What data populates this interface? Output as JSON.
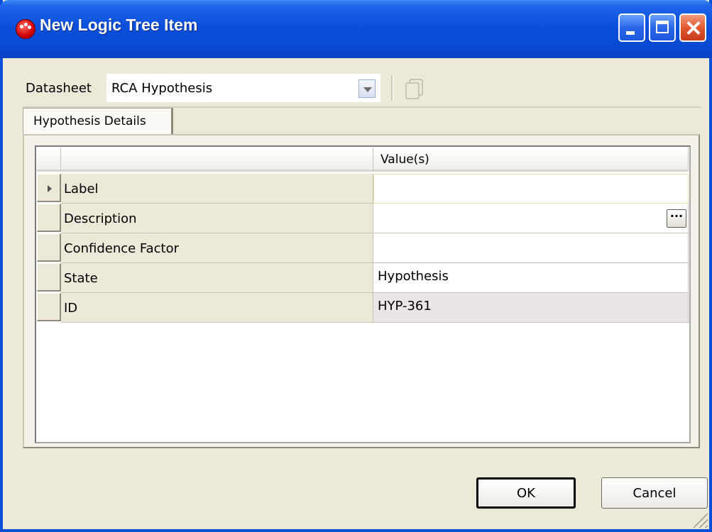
{
  "window": {
    "title": "New Logic Tree Item",
    "app_icon": "red-ball-icon",
    "controls": [
      "minimize-icon",
      "maximize-icon",
      "close-icon"
    ]
  },
  "datasheet": {
    "label": "Datasheet",
    "value": "RCA Hypothesis"
  },
  "tabs": [
    {
      "label": "Hypothesis Details",
      "selected": true
    }
  ],
  "grid": {
    "columns": [
      "",
      "Value(s)"
    ],
    "rows": [
      {
        "label": "Label",
        "value": "",
        "current": true
      },
      {
        "label": "Description",
        "value": "",
        "has_ellipsis": true
      },
      {
        "label": "Confidence Factor",
        "value": ""
      },
      {
        "label": "State",
        "value": "Hypothesis"
      },
      {
        "label": "ID",
        "value": "HYP-361",
        "read_only": true
      }
    ]
  },
  "buttons": {
    "ok": "OK",
    "cancel": "Cancel"
  },
  "colors": {
    "titlebar": "#0a50dc",
    "dialog_bg": "#ece9d8",
    "readonly_cell": "#eae5e6"
  }
}
